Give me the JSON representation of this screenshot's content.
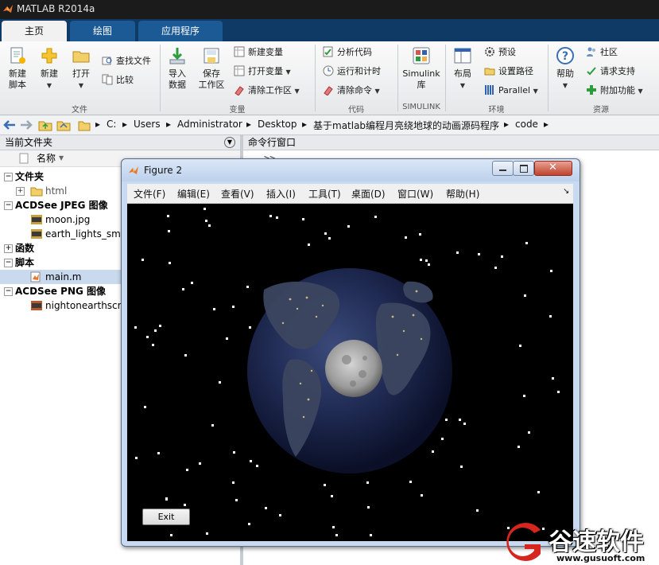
{
  "app": {
    "title": "MATLAB R2014a"
  },
  "tabs": [
    {
      "label": "主页",
      "active": true
    },
    {
      "label": "绘图",
      "active": false
    },
    {
      "label": "应用程序",
      "active": false
    }
  ],
  "ribbon": {
    "file": {
      "new_script": "新建\n脚本",
      "new": "新建",
      "open": "打开",
      "find_files": "查找文件",
      "compare": "比较",
      "group": "文件"
    },
    "variable": {
      "import": "导入\n数据",
      "save_ws": "保存\n工作区",
      "new_var": "新建变量",
      "open_var": "打开变量",
      "clear_ws": "清除工作区",
      "group": "变量"
    },
    "code": {
      "analyze": "分析代码",
      "run_time": "运行和计时",
      "clear_cmd": "清除命令",
      "group": "代码"
    },
    "simulink": {
      "lib": "Simulink\n库",
      "group": "SIMULINK"
    },
    "env": {
      "layout": "布局",
      "prefs": "预设",
      "set_path": "设置路径",
      "parallel": "Parallel",
      "group": "环境"
    },
    "resources": {
      "help": "帮助",
      "community": "社区",
      "request_support": "请求支持",
      "addons": "附加功能",
      "group": "资源"
    }
  },
  "address": {
    "crumbs": [
      "C:",
      "Users",
      "Administrator",
      "Desktop",
      "基于matlab编程月亮绕地球的动画源码程序",
      "code"
    ]
  },
  "left_panel": {
    "title": "当前文件夹",
    "col_name": "名称",
    "rows": [
      {
        "kind": "group",
        "label": "文件夹"
      },
      {
        "kind": "item",
        "label": "html",
        "icon": "folder"
      },
      {
        "kind": "group",
        "label": "ACDSee JPEG 图像"
      },
      {
        "kind": "item",
        "label": "moon.jpg",
        "icon": "jpg"
      },
      {
        "kind": "item",
        "label": "earth_lights_sma",
        "icon": "jpg"
      },
      {
        "kind": "group",
        "label": "函数"
      },
      {
        "kind": "group",
        "label": "脚本"
      },
      {
        "kind": "item",
        "label": "main.m",
        "icon": "m",
        "selected": true
      },
      {
        "kind": "group",
        "label": "ACDSee PNG 图像"
      },
      {
        "kind": "item",
        "label": "nightonearthscre",
        "icon": "png"
      }
    ]
  },
  "command_window": {
    "title": "命令行窗口",
    "prompt": ">>"
  },
  "figure": {
    "title": "Figure 2",
    "menu": [
      "文件(F)",
      "编辑(E)",
      "查看(V)",
      "插入(I)",
      "工具(T)",
      "桌面(D)",
      "窗口(W)",
      "帮助(H)"
    ],
    "exit_label": "Exit"
  },
  "watermark": {
    "cn": "谷速软件",
    "url": "www.gusuoft.com"
  }
}
